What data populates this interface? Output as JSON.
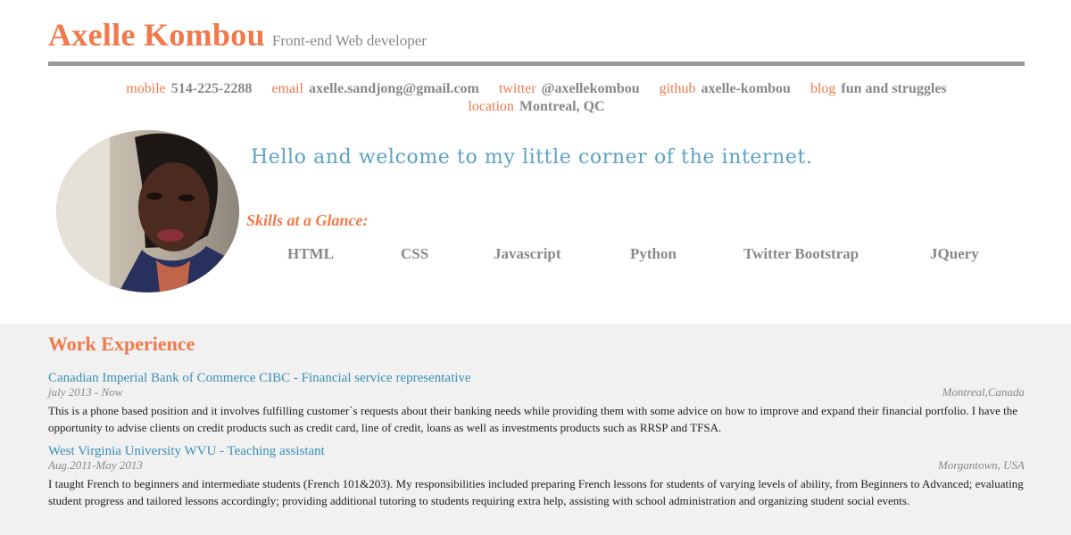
{
  "header": {
    "name": "Axelle Kombou",
    "tagline": "Front-end Web developer"
  },
  "contacts": [
    {
      "label": "mobile",
      "value": "514-225-2288"
    },
    {
      "label": "email",
      "value": "axelle.sandjong@gmail.com"
    },
    {
      "label": "twitter",
      "value": "@axellekombou"
    },
    {
      "label": "github",
      "value": "axelle-kombou"
    },
    {
      "label": "blog",
      "value": "fun and struggles"
    },
    {
      "label": "location",
      "value": "Montreal, QC"
    }
  ],
  "welcome": "Hello and welcome to my little corner of the internet.",
  "skills": {
    "title": "Skills at a Glance:",
    "items": [
      "HTML",
      "CSS",
      "Javascript",
      "Python",
      "Twitter Bootstrap",
      "JQuery"
    ]
  },
  "work": {
    "title": "Work Experience",
    "jobs": [
      {
        "title": "Canadian Imperial Bank of Commerce CIBC - Financial service representative",
        "dates": "july 2013 - Now",
        "place": "Montreal,Canada",
        "description": "This is a phone based position and it involves fulfilling customer`s requests about their banking needs while providing them with some advice on how to improve and expand their financial portfolio. I have the opportunity to advise clients on credit products such as credit card, line of credit, loans as well as investments products such as RRSP and TFSA."
      },
      {
        "title": "West Virginia University WVU - Teaching assistant",
        "dates": "Aug.2011-May 2013",
        "place": "Morgantown, USA",
        "description": "I taught French to beginners and intermediate students (French 101&203). My responsibilities included preparing French lessons for students of varying levels of ability, from Beginners to Advanced; evaluating student progress and tailored lessons accordingly; providing additional tutoring to students requiring extra help, assisting with school administration and organizing student social events."
      }
    ]
  }
}
